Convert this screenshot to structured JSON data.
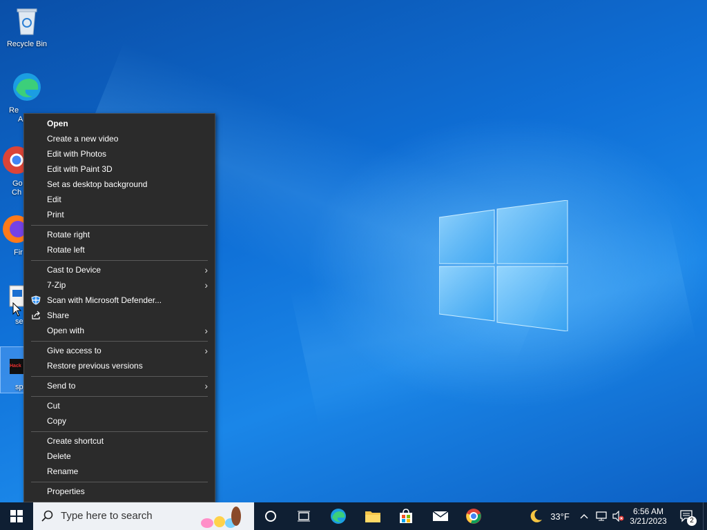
{
  "desktop": {
    "icons": [
      {
        "label": "Recycle Bin"
      },
      {
        "label": "Re",
        "label2": "A"
      },
      {
        "label": "Go",
        "label2": "Ch"
      },
      {
        "label": "Fir"
      },
      {
        "label": "se"
      },
      {
        "label": "sp",
        "thumb_text": "Hack"
      }
    ]
  },
  "context_menu": {
    "items": [
      {
        "label": "Open"
      },
      {
        "label": "Create a new video"
      },
      {
        "label": "Edit with Photos"
      },
      {
        "label": "Edit with Paint 3D"
      },
      {
        "label": "Set as desktop background"
      },
      {
        "label": "Edit"
      },
      {
        "label": "Print"
      },
      {
        "label": "Rotate right"
      },
      {
        "label": "Rotate left"
      },
      {
        "label": "Cast to Device"
      },
      {
        "label": "7-Zip"
      },
      {
        "label": "Scan with Microsoft Defender..."
      },
      {
        "label": "Share"
      },
      {
        "label": "Open with"
      },
      {
        "label": "Give access to"
      },
      {
        "label": "Restore previous versions"
      },
      {
        "label": "Send to"
      },
      {
        "label": "Cut"
      },
      {
        "label": "Copy"
      },
      {
        "label": "Create shortcut"
      },
      {
        "label": "Delete"
      },
      {
        "label": "Rename"
      },
      {
        "label": "Properties"
      }
    ],
    "submenu_arrow": "›"
  },
  "taskbar": {
    "search_placeholder": "Type here to search",
    "weather": {
      "temp": "33°F"
    },
    "clock": {
      "time": "6:56 AM",
      "date": "3/21/2023"
    },
    "notification_count": "2",
    "tray_chevron": "^"
  },
  "colors": {
    "accent": "#0f6fd6",
    "menu_bg": "#2b2b2b",
    "taskbar_bg": "#0f1f33"
  }
}
